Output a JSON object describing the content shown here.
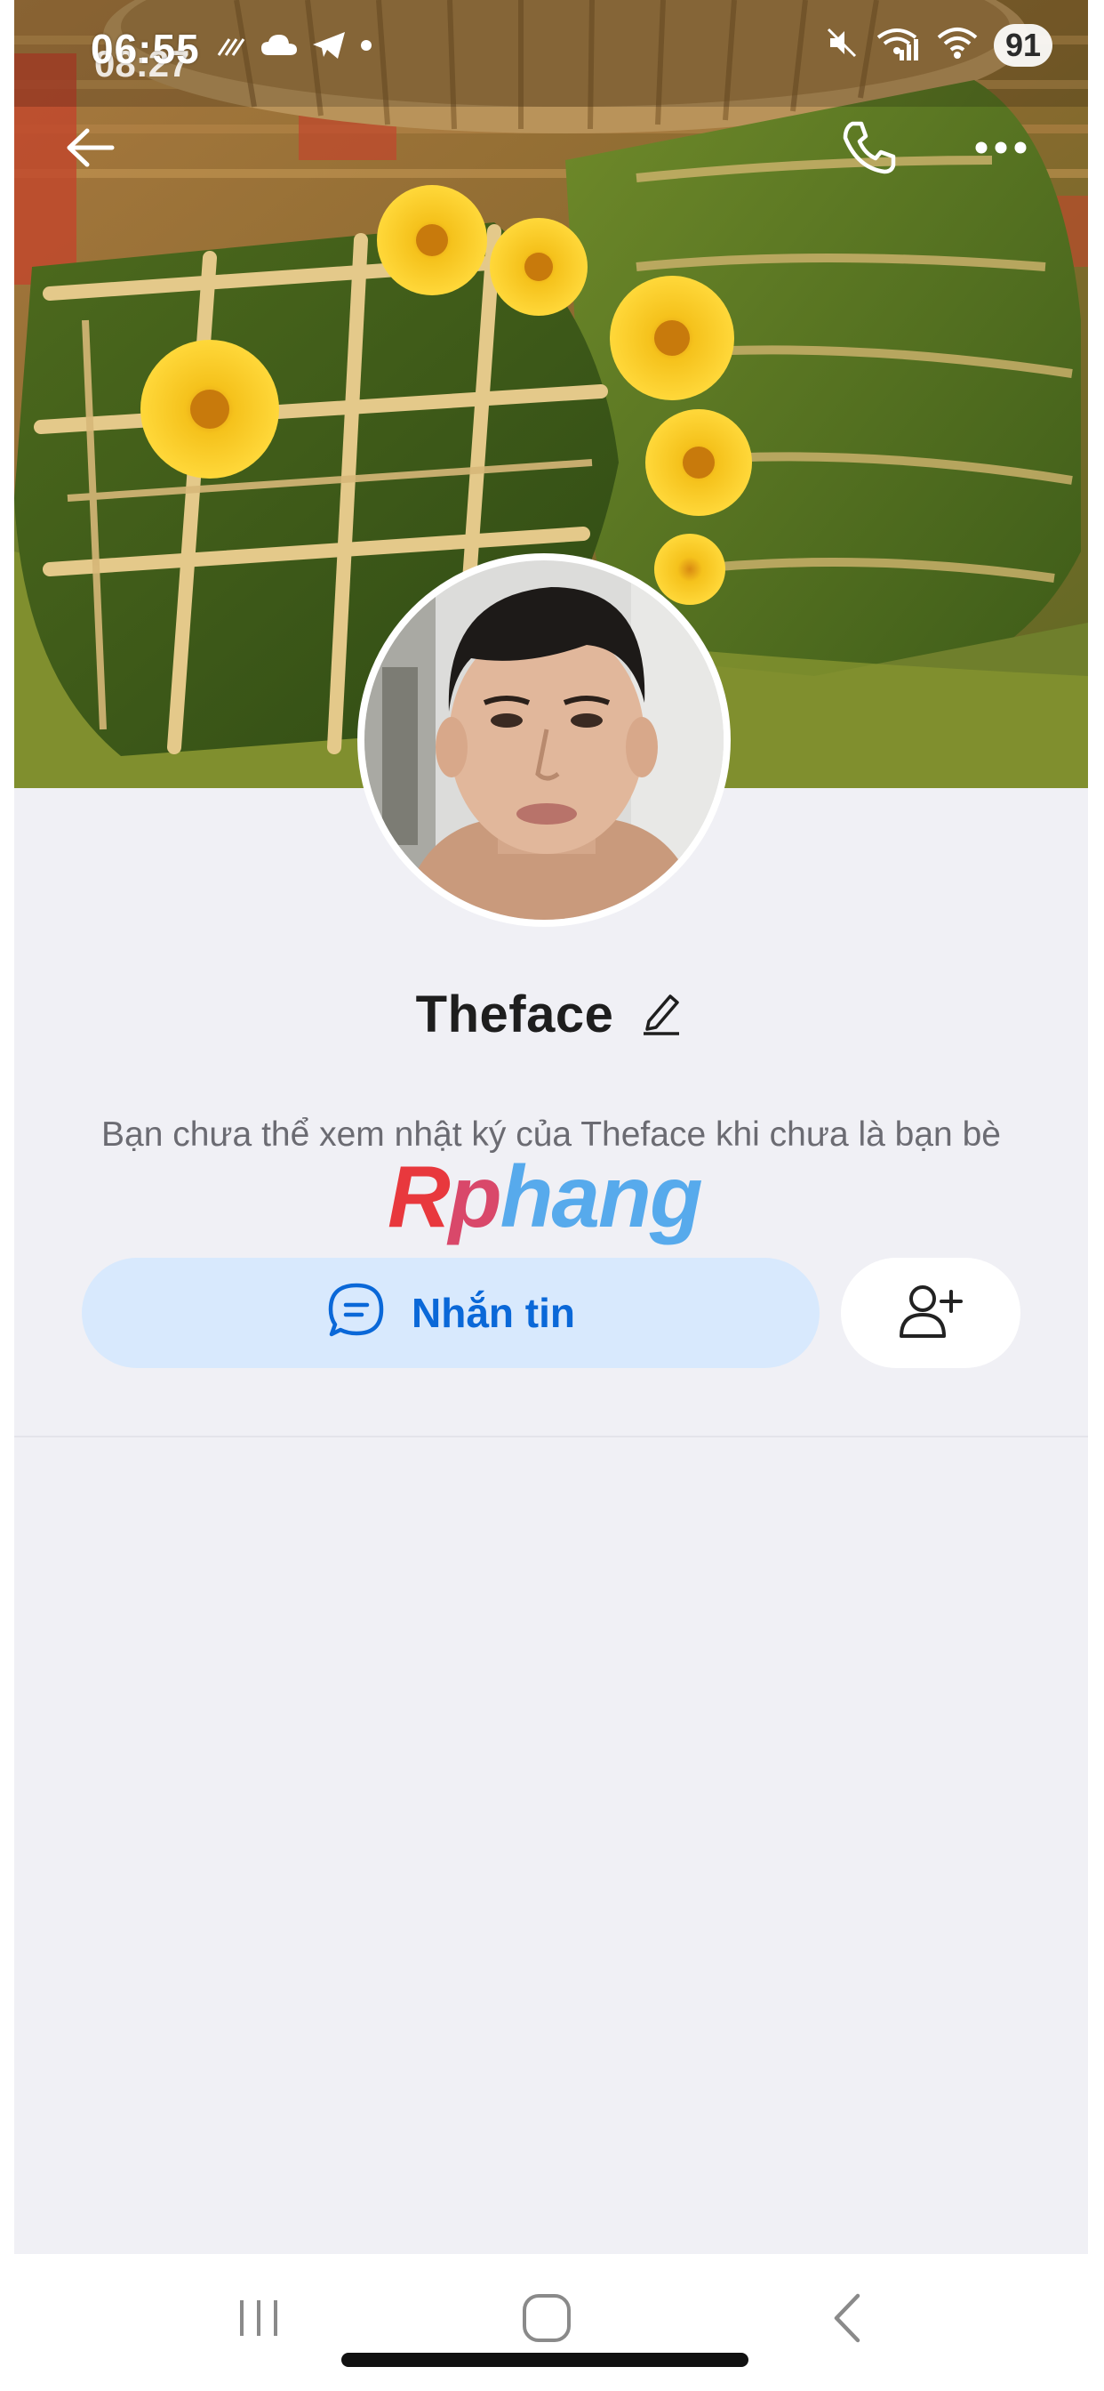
{
  "status_bar": {
    "time": "06:55",
    "time_secondary": "08:27",
    "battery": "91"
  },
  "profile": {
    "name": "Theface",
    "info_text": "Bạn chưa thể xem nhật ký của Theface khi chưa là bạn bè"
  },
  "actions": {
    "message_label": "Nhắn tin"
  },
  "watermark": {
    "letter_1": "R",
    "letter_2": "p",
    "rest": "hang"
  },
  "icons": {
    "back": "back-arrow-icon",
    "call": "phone-icon",
    "more": "more-dots-icon",
    "edit": "pencil-icon",
    "message": "chat-bubble-icon",
    "add_friend": "add-user-icon",
    "nav_recent": "recent-apps-icon",
    "nav_home": "home-icon",
    "nav_back": "nav-back-icon"
  },
  "colors": {
    "accent": "#0a68d8",
    "message_button_bg": "#d8e9fd",
    "page_bg": "#f0f0f5"
  }
}
